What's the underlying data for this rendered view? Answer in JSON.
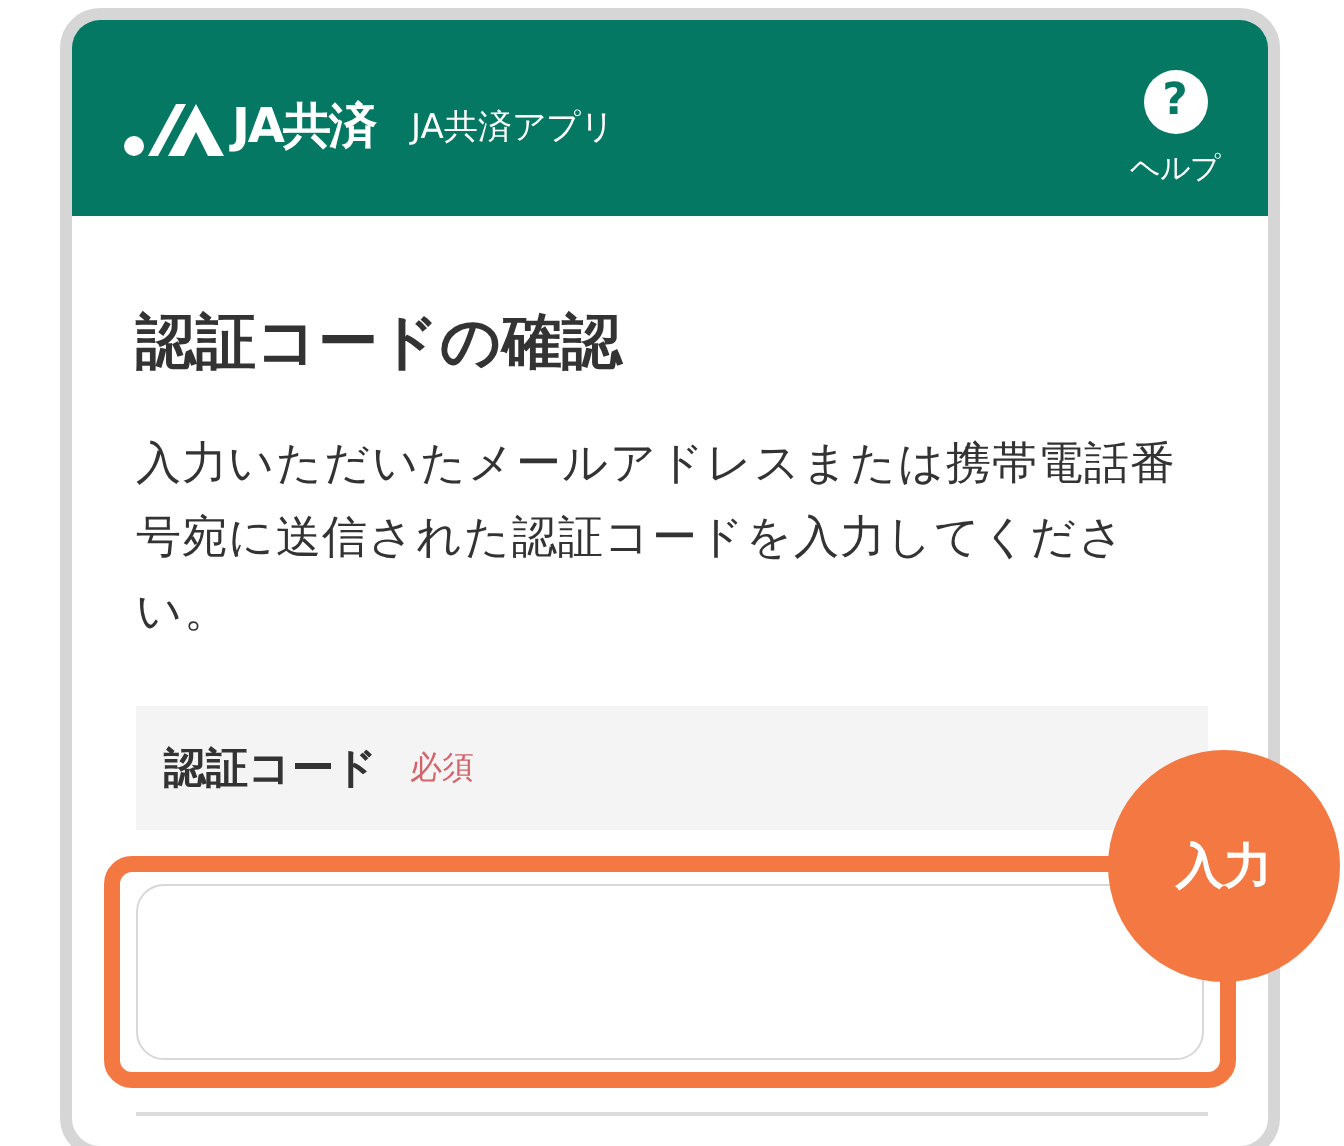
{
  "header": {
    "logo_text": "JA共済",
    "app_name": "JA共済アプリ",
    "help": {
      "icon": "?",
      "label": "ヘルプ"
    }
  },
  "title": "認証コードの確認",
  "description": "入力いただいたメールアドレスまたは携帯電話番号宛に送信された認証コードを入力してください。",
  "field": {
    "label": "認証コード",
    "required": "必須",
    "highlighted": true,
    "badge": "入力"
  }
}
